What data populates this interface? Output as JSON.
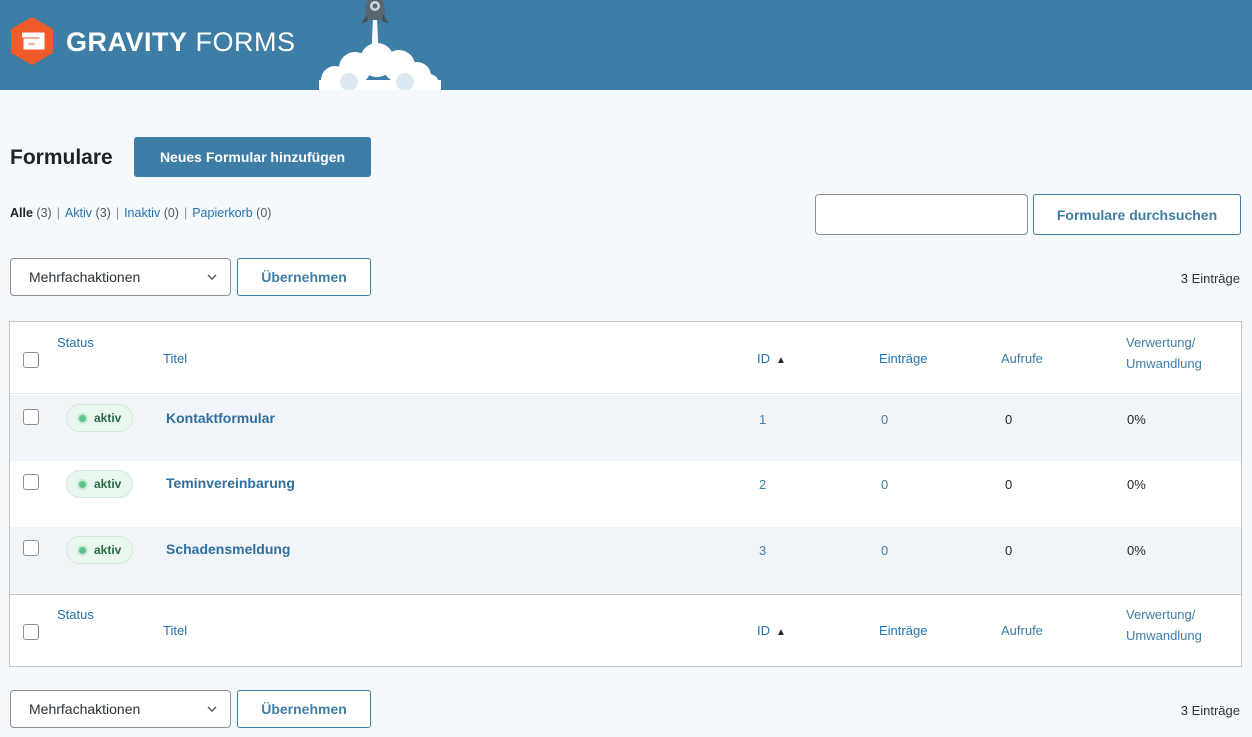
{
  "header": {
    "brand_bold": "GRAVITY",
    "brand_light": " FORMS",
    "logo_icon": "gravity-forms-logo",
    "rocket_icon": "rocket-launch",
    "bg_color": "#3e7da6"
  },
  "page": {
    "title": "Formulare",
    "add_button": "Neues Formular hinzufügen"
  },
  "filters": [
    {
      "label": "Alle",
      "count": "(3)",
      "current": true
    },
    {
      "label": "Aktiv",
      "count": "(3)",
      "current": false
    },
    {
      "label": "Inaktiv",
      "count": "(0)",
      "current": false
    },
    {
      "label": "Papierkorb",
      "count": "(0)",
      "current": false
    }
  ],
  "separator": "|",
  "search": {
    "value": "",
    "placeholder": "",
    "button": "Formulare durchsuchen"
  },
  "bulk": {
    "selected": "Mehrfachaktionen",
    "apply": "Übernehmen",
    "count_label": "3 Einträge"
  },
  "table": {
    "columns": {
      "status": "Status",
      "title": "Titel",
      "id": "ID",
      "entries": "Einträge",
      "views": "Aufrufe",
      "conversion_1": "Verwertung/",
      "conversion_2": "Umwandlung"
    },
    "sort_indicator": "▲",
    "rows": [
      {
        "status": "aktiv",
        "title": "Kontaktformular",
        "id": "1",
        "entries": "0",
        "views": "0",
        "conversion": "0%"
      },
      {
        "status": "aktiv",
        "title": "Teminvereinbarung",
        "id": "2",
        "entries": "0",
        "views": "0",
        "conversion": "0%"
      },
      {
        "status": "aktiv",
        "title": "Schadensmeldung",
        "id": "3",
        "entries": "0",
        "views": "0",
        "conversion": "0%"
      }
    ]
  },
  "colors": {
    "primary": "#3e7da6",
    "link": "#2271b1",
    "active_badge_bg": "#eaf7ef",
    "active_badge_text": "#276a43",
    "active_dot": "#60c38b"
  }
}
